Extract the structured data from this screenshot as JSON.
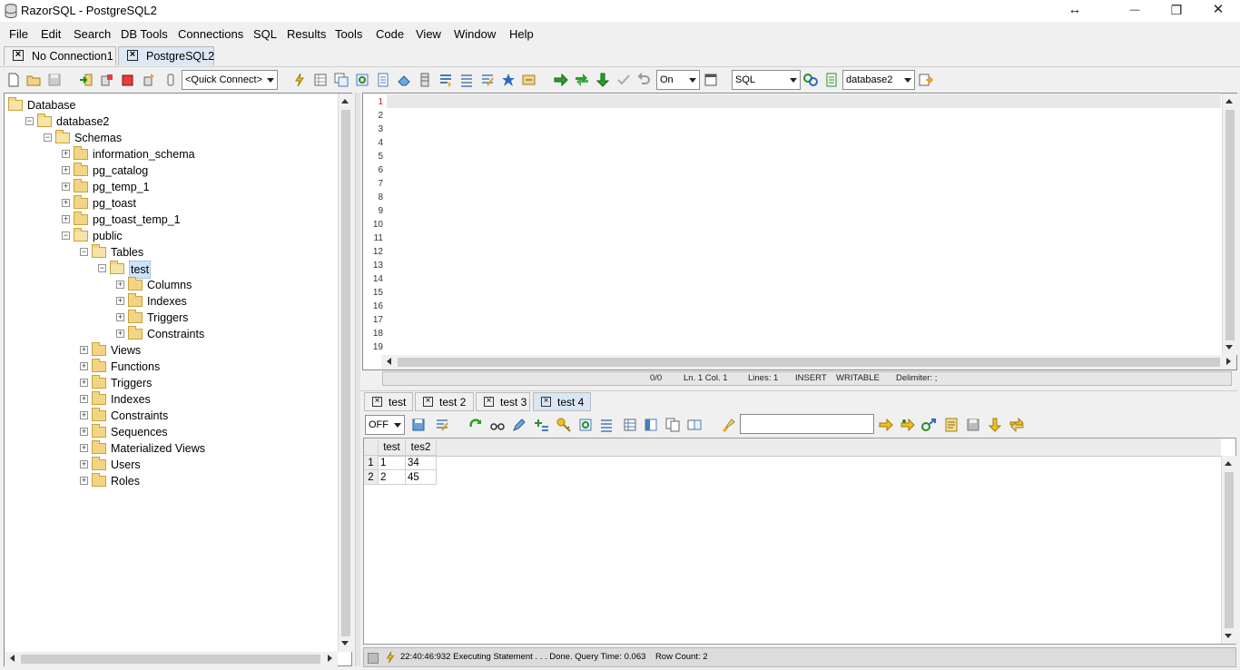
{
  "window": {
    "title": "RazorSQL - PostgreSQL2",
    "controls": {
      "restore_arrows": "↔",
      "minimize": "—",
      "maximize": "❐",
      "close": "✕"
    }
  },
  "menu": [
    "File",
    "Edit",
    "Search",
    "DB Tools",
    "Connections",
    "SQL",
    "Results",
    "Tools",
    "Code",
    "View",
    "Window",
    "Help"
  ],
  "connection_tabs": [
    {
      "label": "No Connection1",
      "active": false
    },
    {
      "label": "PostgreSQL2",
      "active": true
    }
  ],
  "toolbar": {
    "quick_connect": "<Quick Connect>",
    "autocommit": "On",
    "sql_type": "SQL",
    "database": "database2"
  },
  "tree": {
    "root": "Database",
    "database": "database2",
    "schemas_label": "Schemas",
    "schemas": [
      "information_schema",
      "pg_catalog",
      "pg_temp_1",
      "pg_toast",
      "pg_toast_temp_1"
    ],
    "public": "public",
    "tables_label": "Tables",
    "selected_table": "test",
    "table_children": [
      "Columns",
      "Indexes",
      "Triggers",
      "Constraints"
    ],
    "public_children": [
      "Views",
      "Functions",
      "Triggers",
      "Indexes",
      "Constraints",
      "Sequences",
      "Materialized Views",
      "Users",
      "Roles"
    ]
  },
  "editor": {
    "line_numbers": [
      "1",
      "2",
      "3",
      "4",
      "5",
      "6",
      "7",
      "8",
      "9",
      "10",
      "11",
      "12",
      "13",
      "14",
      "15",
      "16",
      "17",
      "18",
      "19"
    ],
    "status": {
      "position": "0/0",
      "line_col": "Ln. 1 Col. 1",
      "lines": "Lines: 1",
      "mode": "INSERT",
      "writable": "WRITABLE",
      "delimiter": "Delimiter: ;"
    }
  },
  "result_tabs": [
    {
      "label": "test",
      "active": false
    },
    {
      "label": "test 2",
      "active": false
    },
    {
      "label": "test 3",
      "active": false
    },
    {
      "label": "test 4",
      "active": true
    }
  ],
  "results_toolbar": {
    "mode": "OFF",
    "filter_value": ""
  },
  "results": {
    "columns": [
      "test",
      "tes2"
    ],
    "rows": [
      {
        "num": "1",
        "cells": [
          "1",
          "34"
        ]
      },
      {
        "num": "2",
        "cells": [
          "2",
          "45"
        ]
      }
    ]
  },
  "status_bar": "22:40:46:932 Executing Statement . . . Done. Query Time: 0.063    Row Count: 2",
  "colors": {
    "selection": "#cde4fb",
    "active_tab": "#dde8f4",
    "folder": "#f2d584",
    "current_line": "#e8e8e8"
  }
}
